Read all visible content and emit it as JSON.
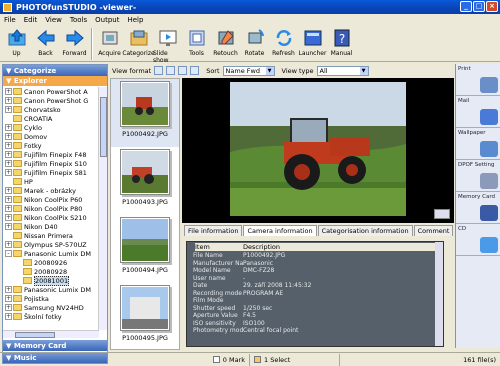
{
  "window": {
    "title": "PHOTOfunSTUDIO -viewer-"
  },
  "menu": [
    "File",
    "Edit",
    "View",
    "Tools",
    "Output",
    "Help"
  ],
  "toolbar": [
    {
      "label": "Up",
      "icon": "up-folder-icon"
    },
    {
      "label": "Back",
      "icon": "back-arrow-icon"
    },
    {
      "label": "Forward",
      "icon": "forward-arrow-icon"
    },
    {
      "label": "Acquire",
      "icon": "acquire-icon"
    },
    {
      "label": "Categorize",
      "icon": "categorize-icon"
    },
    {
      "label": "Slide show",
      "icon": "slideshow-icon"
    },
    {
      "label": "Tools",
      "icon": "tools-icon"
    },
    {
      "label": "Retouch",
      "icon": "retouch-icon"
    },
    {
      "label": "Rotate",
      "icon": "rotate-icon"
    },
    {
      "label": "Refresh",
      "icon": "refresh-icon"
    },
    {
      "label": "Launcher",
      "icon": "launcher-icon"
    },
    {
      "label": "Manual",
      "icon": "manual-icon"
    }
  ],
  "left": {
    "categorize": "Categorize",
    "explorer": "Explorer",
    "tree": [
      {
        "label": "Canon PowerShot A",
        "exp": "+"
      },
      {
        "label": "Canon PowerShot G",
        "exp": "+"
      },
      {
        "label": "Chorvatsko",
        "exp": "+"
      },
      {
        "label": "CROATIA",
        "exp": ""
      },
      {
        "label": "Cyklo",
        "exp": "+"
      },
      {
        "label": "Domov",
        "exp": "+"
      },
      {
        "label": "Fotky",
        "exp": "+"
      },
      {
        "label": "Fujifilm Finepix F48",
        "exp": "+"
      },
      {
        "label": "Fujifilm Finepix S10",
        "exp": "+"
      },
      {
        "label": "Fujifilm Finepix S81",
        "exp": "+"
      },
      {
        "label": "HP",
        "exp": ""
      },
      {
        "label": "Marek - obrázky",
        "exp": "+"
      },
      {
        "label": "Nikon CoolPix P60",
        "exp": "+"
      },
      {
        "label": "Nikon CoolPix P80",
        "exp": "+"
      },
      {
        "label": "Nikon CoolPix S210",
        "exp": "+"
      },
      {
        "label": "Nikon D40",
        "exp": "+"
      },
      {
        "label": "Nissan Primera",
        "exp": ""
      },
      {
        "label": "Olympus SP-570UZ",
        "exp": "+"
      },
      {
        "label": "Panasonic Lumix DM",
        "exp": "-"
      },
      {
        "label": "20080926",
        "exp": "",
        "indent": true
      },
      {
        "label": "20080928",
        "exp": "",
        "indent": true
      },
      {
        "label": "20081001",
        "exp": "",
        "indent": true,
        "selected": true
      },
      {
        "label": "Panasonic Lumix DM",
        "exp": "+"
      },
      {
        "label": "Pojistka",
        "exp": "+"
      },
      {
        "label": "Samsung NV24HD",
        "exp": "+"
      },
      {
        "label": "Školní fotky",
        "exp": "+"
      }
    ],
    "memory_card": "Memory Card",
    "music": "Music"
  },
  "viewbar": {
    "view_format": "View format",
    "sort": "Sort",
    "sort_value": "Name Fwd",
    "view_type": "View type",
    "view_type_value": "All"
  },
  "thumbnails": [
    {
      "name": "P1000492.JPG"
    },
    {
      "name": "P1000493.JPG"
    },
    {
      "name": "P1000494.JPG"
    },
    {
      "name": "P1000495.JPG"
    }
  ],
  "info": {
    "tabs": [
      "File information",
      "Camera information",
      "Categorisation information",
      "Comment"
    ],
    "active_tab": 1,
    "col_item": "Item",
    "col_desc": "Description",
    "rows": [
      {
        "k": "File Name",
        "v": "P1000492.JPG"
      },
      {
        "k": "Manufacturer Na...",
        "v": "Panasonic"
      },
      {
        "k": "Model Name",
        "v": "DMC-FZ28"
      },
      {
        "k": "User name",
        "v": "-"
      },
      {
        "k": "Date",
        "v": "29. září 2008 11:45:32"
      },
      {
        "k": "Recording mode",
        "v": "PROGRAM AE"
      },
      {
        "k": "Film Mode",
        "v": ""
      },
      {
        "k": "Shutter speed",
        "v": "1/250 sec"
      },
      {
        "k": "Aperture Value",
        "v": "F4.5"
      },
      {
        "k": "ISO sensitivity",
        "v": "ISO100"
      },
      {
        "k": "Photometry mode",
        "v": "Central focal point"
      }
    ]
  },
  "right_panel": [
    {
      "label": "Print",
      "color": "#6a8fc8"
    },
    {
      "label": "Mail",
      "color": "#4a7ad8"
    },
    {
      "label": "Wallpaper",
      "color": "#5a8ad0"
    },
    {
      "label": "DPOF Setting",
      "color": "#8a9ab8"
    },
    {
      "label": "Memory Card",
      "color": "#3a5aa8"
    },
    {
      "label": "CD",
      "color": "#4a9ae8"
    }
  ],
  "status": {
    "mark": "0 Mark",
    "select": "1 Select",
    "files": "161 file(s)"
  }
}
